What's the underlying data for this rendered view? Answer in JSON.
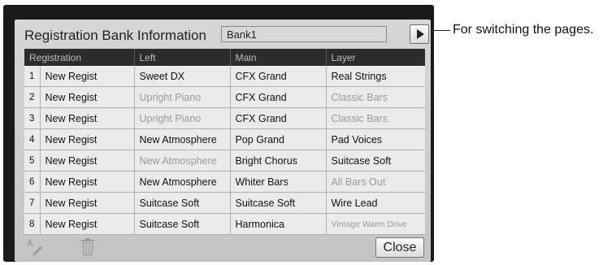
{
  "panel": {
    "title": "Registration Bank Information",
    "bank_name": "Bank1",
    "close_label": "Close"
  },
  "icons": {
    "page": "play-triangle-icon",
    "rename": "rename-pencil-icon",
    "delete": "trash-icon"
  },
  "table": {
    "headers": [
      "Registration",
      "Left",
      "Main",
      "Layer"
    ],
    "rows": [
      {
        "num": "1",
        "name": "New Regist",
        "left": "Sweet DX",
        "main": "CFX Grand",
        "layer": "Real Strings"
      },
      {
        "num": "2",
        "name": "New Regist",
        "left": "Upright Piano",
        "main": "CFX Grand",
        "layer": "Classic Bars"
      },
      {
        "num": "3",
        "name": "New Regist",
        "left": "Upright Piano",
        "main": "CFX Grand",
        "layer": "Classic Bars"
      },
      {
        "num": "4",
        "name": "New Regist",
        "left": "New Atmosphere",
        "main": "Pop Grand",
        "layer": "Pad Voices"
      },
      {
        "num": "5",
        "name": "New Regist",
        "left": "New Atmosphere",
        "main": "Bright Chorus",
        "layer": "Suitcase Soft"
      },
      {
        "num": "6",
        "name": "New Regist",
        "left": "New Atmosphere",
        "main": "Whiter Bars",
        "layer": "All Bars Out"
      },
      {
        "num": "7",
        "name": "New Regist",
        "left": "Suitcase Soft",
        "main": "Suitcase Soft",
        "layer": "Wire Lead"
      },
      {
        "num": "8",
        "name": "New Regist",
        "left": "Suitcase Soft",
        "main": "Harmonica",
        "layer": "Vintage Warm Drive"
      }
    ]
  },
  "annotation": {
    "text": "For switching the pages."
  },
  "colors": {
    "frame": "#1a1a1a",
    "header_bg": "#2c2c2c",
    "cell_bg": "#ebebeb",
    "dim_text": "#9a9a9a"
  }
}
